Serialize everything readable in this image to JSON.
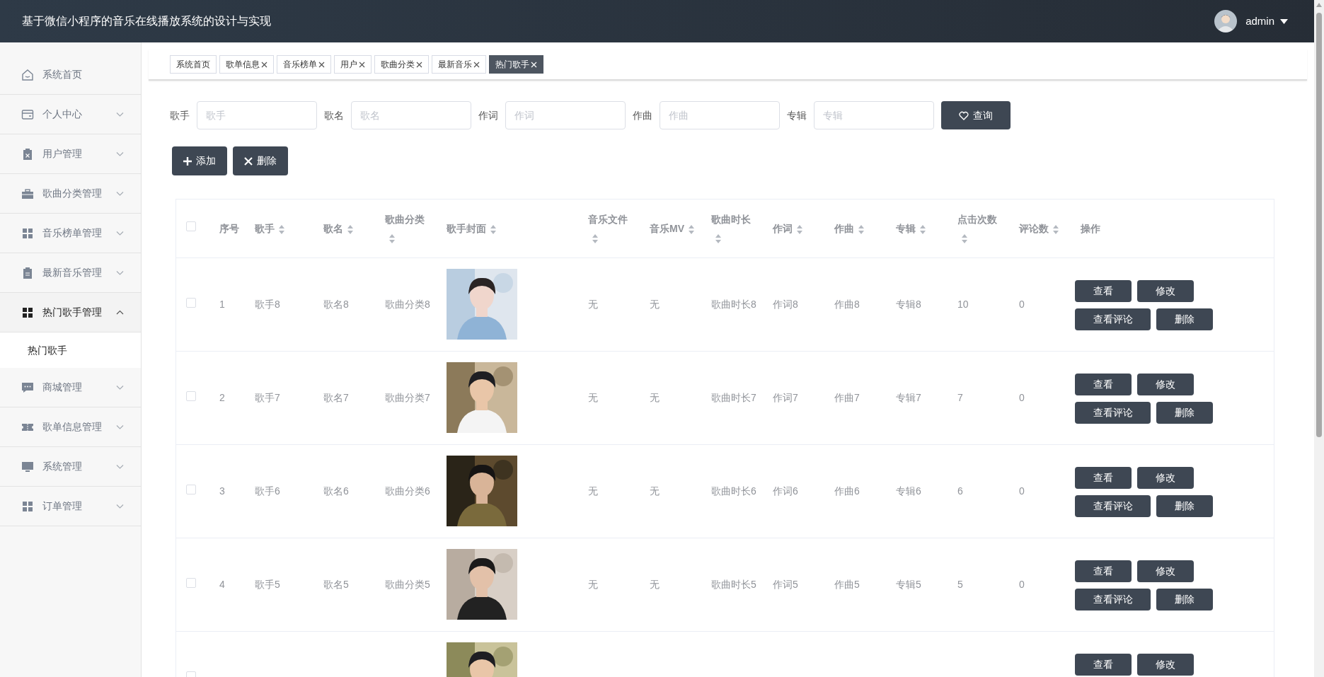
{
  "header": {
    "title": "基于微信小程序的音乐在线播放系统的设计与实现",
    "user": "admin"
  },
  "sidebar": {
    "items": [
      {
        "label": "系统首页",
        "selected": false
      },
      {
        "label": "个人中心",
        "selected": false,
        "expanded": false
      },
      {
        "label": "用户管理",
        "selected": false,
        "expanded": false
      },
      {
        "label": "歌曲分类管理",
        "selected": false,
        "expanded": false
      },
      {
        "label": "音乐榜单管理",
        "selected": false,
        "expanded": false
      },
      {
        "label": "最新音乐管理",
        "selected": false,
        "expanded": false
      },
      {
        "label": "热门歌手管理",
        "selected": true,
        "expanded": true,
        "children": [
          {
            "label": "热门歌手",
            "selected": true
          }
        ]
      },
      {
        "label": "商城管理",
        "selected": false,
        "expanded": false
      },
      {
        "label": "歌单信息管理",
        "selected": false,
        "expanded": false
      },
      {
        "label": "系统管理",
        "selected": false,
        "expanded": false
      },
      {
        "label": "订单管理",
        "selected": false,
        "expanded": false
      }
    ]
  },
  "tabs": [
    {
      "label": "系统首页",
      "closable": false,
      "selected": false
    },
    {
      "label": "歌单信息",
      "closable": true,
      "selected": false
    },
    {
      "label": "音乐榜单",
      "closable": true,
      "selected": false
    },
    {
      "label": "用户",
      "closable": true,
      "selected": false
    },
    {
      "label": "歌曲分类",
      "closable": true,
      "selected": false
    },
    {
      "label": "最新音乐",
      "closable": true,
      "selected": false
    },
    {
      "label": "热门歌手",
      "closable": true,
      "selected": true
    }
  ],
  "search": {
    "fields": [
      {
        "label": "歌手",
        "placeholder": "歌手"
      },
      {
        "label": "歌名",
        "placeholder": "歌名"
      },
      {
        "label": "作词",
        "placeholder": "作词"
      },
      {
        "label": "作曲",
        "placeholder": "作曲"
      },
      {
        "label": "专辑",
        "placeholder": "专辑"
      }
    ],
    "button": "查询"
  },
  "actions": [
    {
      "kind": "add",
      "label": "添加"
    },
    {
      "kind": "delete",
      "label": "删除"
    }
  ],
  "table": {
    "select_all_checked": false,
    "columns": [
      {
        "label": "序号",
        "sortable": false
      },
      {
        "label": "歌手",
        "sortable": true
      },
      {
        "label": "歌名",
        "sortable": true
      },
      {
        "label": "歌曲分类",
        "sortable": true
      },
      {
        "label": "歌手封面",
        "sortable": true
      },
      {
        "label": "音乐文件",
        "sortable": true
      },
      {
        "label": "音乐MV",
        "sortable": true
      },
      {
        "label": "歌曲时长",
        "sortable": true
      },
      {
        "label": "作词",
        "sortable": true
      },
      {
        "label": "作曲",
        "sortable": true
      },
      {
        "label": "专辑",
        "sortable": true
      },
      {
        "label": "点击次数",
        "sortable": true
      },
      {
        "label": "评论数",
        "sortable": true
      },
      {
        "label": "操作",
        "sortable": false
      }
    ],
    "rows": [
      {
        "checked": false,
        "cells": [
          "1",
          "歌手8",
          "歌名8",
          "歌曲分类8",
          null,
          "无",
          "无",
          "歌曲时长8",
          "作词8",
          "作曲8",
          "专辑8",
          "10",
          "0"
        ],
        "buttons": [
          "查看",
          "修改",
          "查看评论",
          "删除"
        ]
      },
      {
        "checked": false,
        "cells": [
          "2",
          "歌手7",
          "歌名7",
          "歌曲分类7",
          null,
          "无",
          "无",
          "歌曲时长7",
          "作词7",
          "作曲7",
          "专辑7",
          "7",
          "0"
        ],
        "buttons": [
          "查看",
          "修改",
          "查看评论",
          "删除"
        ]
      },
      {
        "checked": false,
        "cells": [
          "3",
          "歌手6",
          "歌名6",
          "歌曲分类6",
          null,
          "无",
          "无",
          "歌曲时长6",
          "作词6",
          "作曲6",
          "专辑6",
          "6",
          "0"
        ],
        "buttons": [
          "查看",
          "修改",
          "查看评论",
          "删除"
        ]
      },
      {
        "checked": false,
        "cells": [
          "4",
          "歌手5",
          "歌名5",
          "歌曲分类5",
          null,
          "无",
          "无",
          "歌曲时长5",
          "作词5",
          "作曲5",
          "专辑5",
          "5",
          "0"
        ],
        "buttons": [
          "查看",
          "修改",
          "查看评论",
          "删除"
        ]
      },
      {
        "checked": false,
        "buttons": [
          "查看",
          "修改"
        ]
      }
    ]
  }
}
